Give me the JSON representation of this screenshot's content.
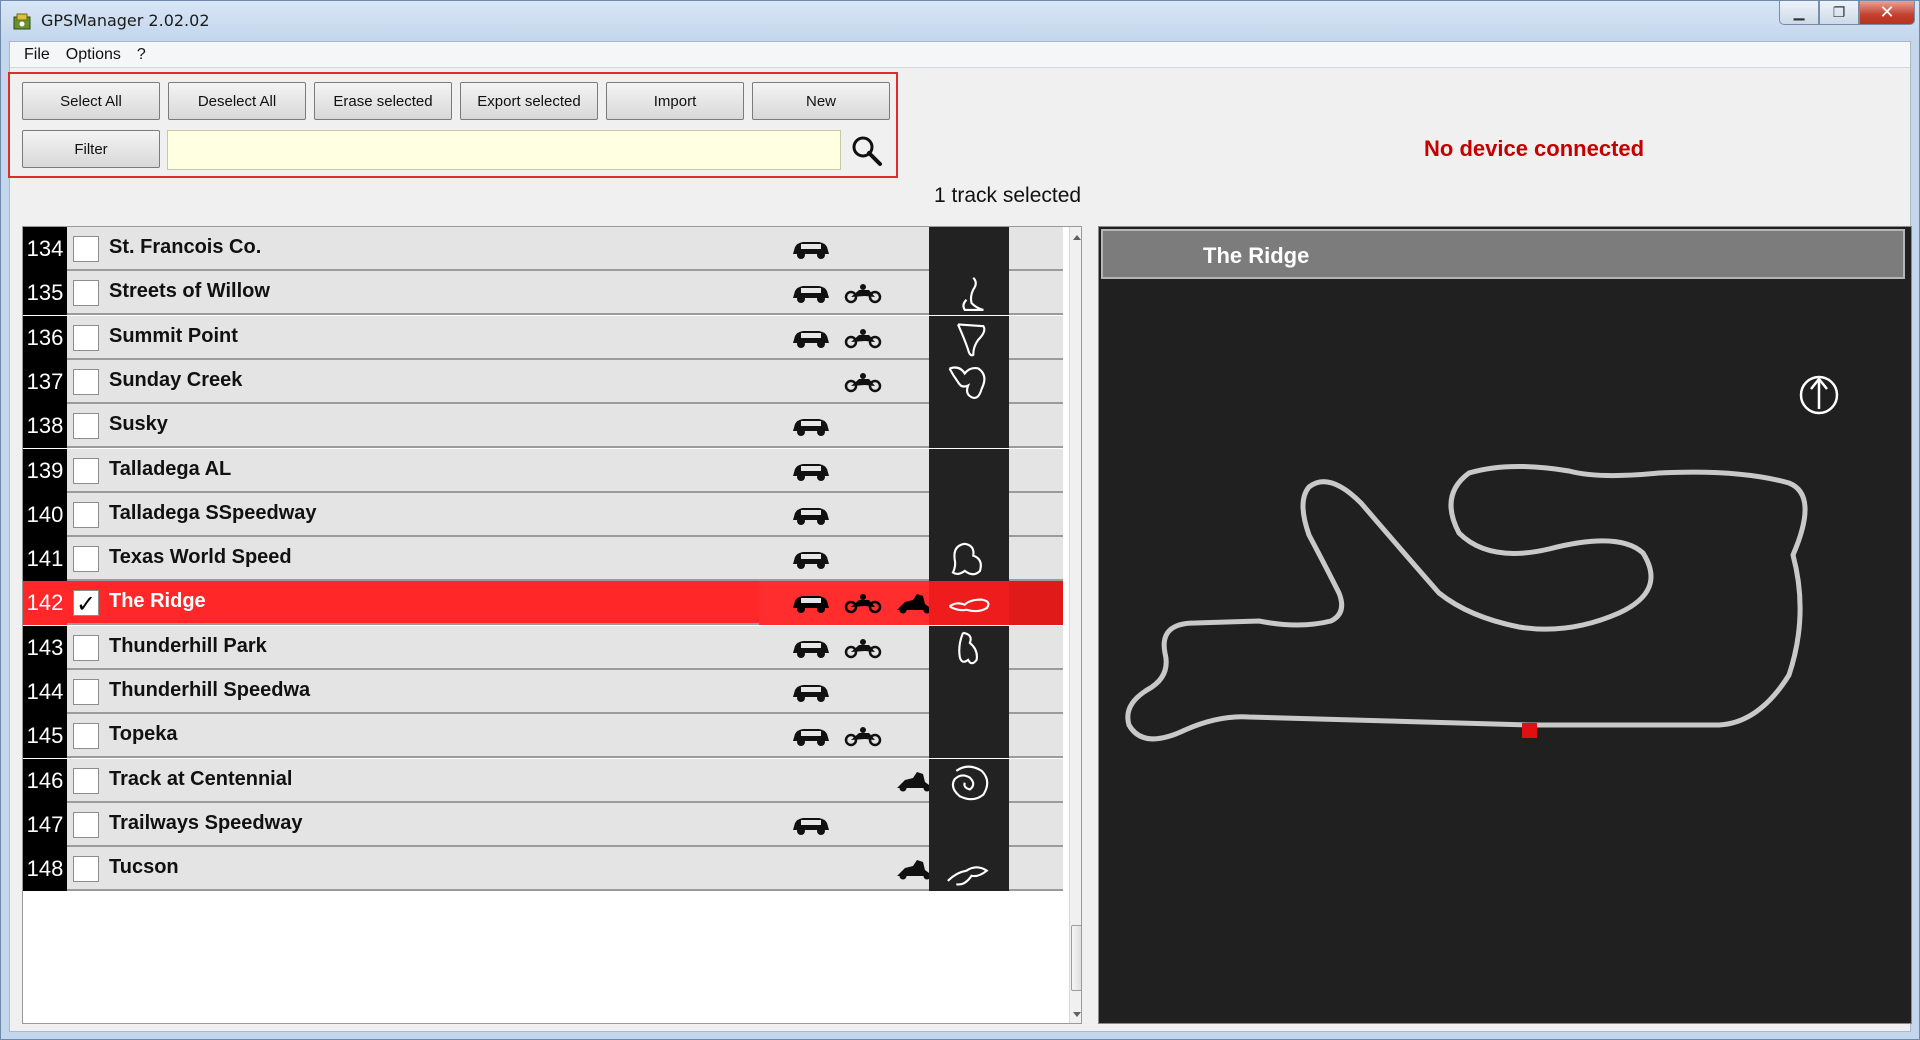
{
  "window": {
    "title": "GPSManager 2.02.02"
  },
  "menu": {
    "file": "File",
    "options": "Options",
    "help": "?"
  },
  "toolbar": {
    "select_all": "Select All",
    "deselect_all": "Deselect All",
    "erase_selected": "Erase selected",
    "export_selected": "Export selected",
    "import": "Import",
    "new": "New",
    "filter": "Filter",
    "filter_value": ""
  },
  "status": {
    "connection": "No device connected",
    "selection": "1 track selected"
  },
  "tracks": [
    {
      "num": "134",
      "name": "St. Francois Co.",
      "checked": false,
      "car": true,
      "moto": false,
      "kart": false
    },
    {
      "num": "135",
      "name": "Streets of Willow",
      "checked": false,
      "car": true,
      "moto": true,
      "kart": false
    },
    {
      "num": "136",
      "name": "Summit Point",
      "checked": false,
      "car": true,
      "moto": true,
      "kart": false
    },
    {
      "num": "137",
      "name": "Sunday Creek",
      "checked": false,
      "car": false,
      "moto": true,
      "kart": false
    },
    {
      "num": "138",
      "name": "Susky",
      "checked": false,
      "car": true,
      "moto": false,
      "kart": false
    },
    {
      "num": "139",
      "name": "Talladega AL",
      "checked": false,
      "car": true,
      "moto": false,
      "kart": false
    },
    {
      "num": "140",
      "name": "Talladega SSpeedway",
      "checked": false,
      "car": true,
      "moto": false,
      "kart": false
    },
    {
      "num": "141",
      "name": "Texas World Speed",
      "checked": false,
      "car": true,
      "moto": false,
      "kart": false
    },
    {
      "num": "142",
      "name": "The Ridge",
      "checked": true,
      "car": true,
      "moto": true,
      "kart": true
    },
    {
      "num": "143",
      "name": "Thunderhill Park",
      "checked": false,
      "car": true,
      "moto": true,
      "kart": false
    },
    {
      "num": "144",
      "name": "Thunderhill Speedwa",
      "checked": false,
      "car": true,
      "moto": false,
      "kart": false
    },
    {
      "num": "145",
      "name": "Topeka",
      "checked": false,
      "car": true,
      "moto": true,
      "kart": false
    },
    {
      "num": "146",
      "name": "Track at Centennial",
      "checked": false,
      "car": false,
      "moto": false,
      "kart": true
    },
    {
      "num": "147",
      "name": "Trailways Speedway",
      "checked": false,
      "car": true,
      "moto": false,
      "kart": false
    },
    {
      "num": "148",
      "name": "Tucson",
      "checked": false,
      "car": false,
      "moto": false,
      "kart": true
    }
  ],
  "selected_track": {
    "name": "The Ridge"
  },
  "icons": {
    "app": "satellite-app-icon",
    "search": "magnifier-icon",
    "car": "car-icon",
    "moto": "motorcycle-icon",
    "kart": "kart-icon",
    "north": "north-arrow-icon"
  },
  "colors": {
    "selected_row": "#ff2727",
    "status_error": "#c40000",
    "toolbar_border": "#e02b2b",
    "filter_bg": "#ffffe1",
    "map_bg": "#202020"
  }
}
